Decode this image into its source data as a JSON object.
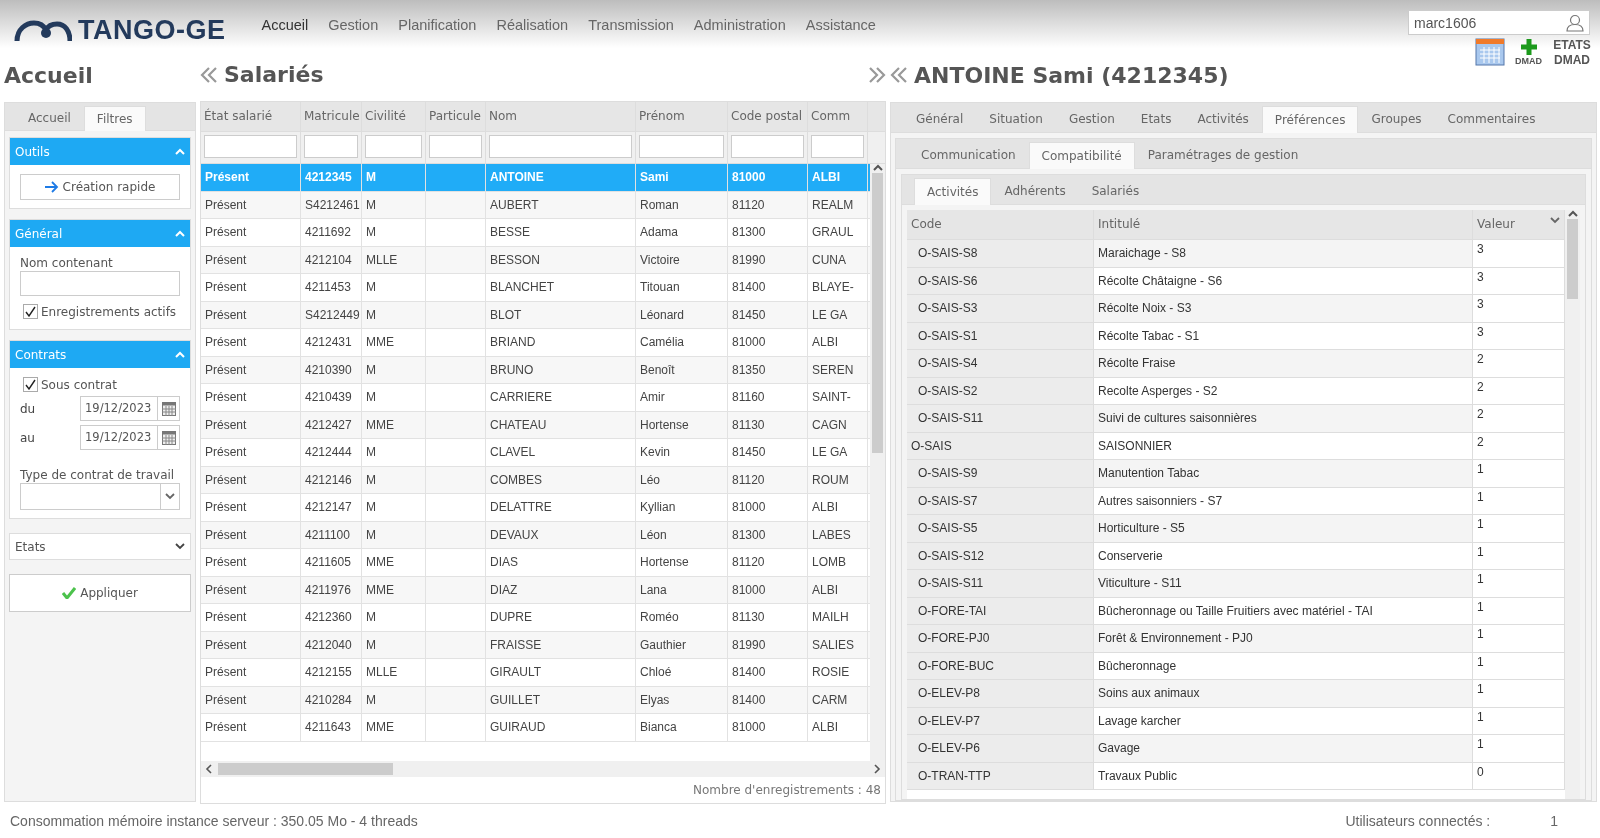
{
  "header": {
    "logo": "TANGO-GE",
    "nav": [
      {
        "label": "Accueil",
        "selected": true
      },
      {
        "label": "Gestion",
        "selected": false
      },
      {
        "label": "Planification",
        "selected": false
      },
      {
        "label": "Réalisation",
        "selected": false
      },
      {
        "label": "Transmission",
        "selected": false
      },
      {
        "label": "Administration",
        "selected": false
      },
      {
        "label": "Assistance",
        "selected": false
      }
    ],
    "user_field": {
      "value": "marc1606"
    },
    "toolbar": [
      {
        "kind": "calendar"
      },
      {
        "kind": "add",
        "label": "DMAD"
      },
      {
        "kind": "text",
        "label": "ETATS DMAD"
      }
    ]
  },
  "left_panel": {
    "title": "Accueil",
    "tabs": [
      {
        "label": "Accueil",
        "selected": false
      },
      {
        "label": "Filtres",
        "selected": true
      }
    ],
    "sections": [
      {
        "kind": "tools",
        "title": "Outils",
        "expanded": true,
        "button": "Création rapide"
      },
      {
        "kind": "general",
        "title": "Général",
        "expanded": true,
        "field_label": "Nom contenant",
        "checkbox": {
          "label": "Enregistrements actifs",
          "checked": true
        }
      },
      {
        "kind": "contracts",
        "title": "Contrats",
        "expanded": true,
        "checkbox": {
          "label": "Sous contrat",
          "checked": true
        },
        "dates": [
          {
            "label": "du",
            "value": "19/12/2023"
          },
          {
            "label": "au",
            "value": "19/12/2023"
          }
        ],
        "select_label": "Type de contrat de travail"
      }
    ],
    "states_dropdown": "Etats",
    "apply_button": "Appliquer"
  },
  "salaries": {
    "title": "Salariés",
    "columns": [
      "État salarié",
      "Matricule",
      "Civilité",
      "Particule",
      "Nom",
      "Prénom",
      "Code postal",
      "Comm"
    ],
    "rows": [
      {
        "selected": true,
        "cells": [
          "Présent",
          "4212345",
          "M",
          "",
          "ANTOINE",
          "Sami",
          "81000",
          "ALBI"
        ]
      },
      {
        "selected": false,
        "cells": [
          "Présent",
          "S4212461",
          "M",
          "",
          "AUBERT",
          "Roman",
          "81120",
          "REALM"
        ]
      },
      {
        "selected": false,
        "cells": [
          "Présent",
          "4211692",
          "M",
          "",
          "BESSE",
          "Adama",
          "81300",
          "GRAUL"
        ]
      },
      {
        "selected": false,
        "cells": [
          "Présent",
          "4212104",
          "MLLE",
          "",
          "BESSON",
          "Victoire",
          "81990",
          "CUNA"
        ]
      },
      {
        "selected": false,
        "cells": [
          "Présent",
          "4211453",
          "M",
          "",
          "BLANCHET",
          "Titouan",
          "81400",
          "BLAYE-"
        ]
      },
      {
        "selected": false,
        "cells": [
          "Présent",
          "S4212449",
          "M",
          "",
          "BLOT",
          "Léonard",
          "81450",
          "LE GA"
        ]
      },
      {
        "selected": false,
        "cells": [
          "Présent",
          "4212431",
          "MME",
          "",
          "BRIAND",
          "Camélia",
          "81000",
          "ALBI"
        ]
      },
      {
        "selected": false,
        "cells": [
          "Présent",
          "4210390",
          "M",
          "",
          "BRUNO",
          "Benoît",
          "81350",
          "SEREN"
        ]
      },
      {
        "selected": false,
        "cells": [
          "Présent",
          "4210439",
          "M",
          "",
          "CARRIERE",
          "Amir",
          "81160",
          "SAINT-"
        ]
      },
      {
        "selected": false,
        "cells": [
          "Présent",
          "4212427",
          "MME",
          "",
          "CHATEAU",
          "Hortense",
          "81130",
          "CAGN"
        ]
      },
      {
        "selected": false,
        "cells": [
          "Présent",
          "4212444",
          "M",
          "",
          "CLAVEL",
          "Kevin",
          "81450",
          "LE GA"
        ]
      },
      {
        "selected": false,
        "cells": [
          "Présent",
          "4212146",
          "M",
          "",
          "COMBES",
          "Léo",
          "81120",
          "ROUM"
        ]
      },
      {
        "selected": false,
        "cells": [
          "Présent",
          "4212147",
          "M",
          "",
          "DELATTRE",
          "Kyllian",
          "81000",
          "ALBI"
        ]
      },
      {
        "selected": false,
        "cells": [
          "Présent",
          "4211100",
          "M",
          "",
          "DEVAUX",
          "Léon",
          "81300",
          "LABES"
        ]
      },
      {
        "selected": false,
        "cells": [
          "Présent",
          "4211605",
          "MME",
          "",
          "DIAS",
          "Hortense",
          "81120",
          "LOMB"
        ]
      },
      {
        "selected": false,
        "cells": [
          "Présent",
          "4211976",
          "MME",
          "",
          "DIAZ",
          "Lana",
          "81000",
          "ALBI"
        ]
      },
      {
        "selected": false,
        "cells": [
          "Présent",
          "4212360",
          "M",
          "",
          "DUPRE",
          "Roméo",
          "81130",
          "MAILH"
        ]
      },
      {
        "selected": false,
        "cells": [
          "Présent",
          "4212040",
          "M",
          "",
          "FRAISSE",
          "Gauthier",
          "81990",
          "SALIES"
        ]
      },
      {
        "selected": false,
        "cells": [
          "Présent",
          "4212155",
          "MLLE",
          "",
          "GIRAULT",
          "Chloé",
          "81400",
          "ROSIE"
        ]
      },
      {
        "selected": false,
        "cells": [
          "Présent",
          "4210284",
          "M",
          "",
          "GUILLET",
          "Elyas",
          "81400",
          "CARM"
        ]
      },
      {
        "selected": false,
        "cells": [
          "Présent",
          "4211643",
          "MME",
          "",
          "GUIRAUD",
          "Bianca",
          "81000",
          "ALBI"
        ]
      }
    ],
    "record_count": "Nombre d'enregistrements : 48"
  },
  "detail": {
    "title": "ANTOINE Sami (4212345)",
    "tabs": [
      {
        "label": "Général",
        "selected": false
      },
      {
        "label": "Situation",
        "selected": false
      },
      {
        "label": "Gestion",
        "selected": false
      },
      {
        "label": "Etats",
        "selected": false
      },
      {
        "label": "Activités",
        "selected": false
      },
      {
        "label": "Préférences",
        "selected": true
      },
      {
        "label": "Groupes",
        "selected": false
      },
      {
        "label": "Commentaires",
        "selected": false
      }
    ],
    "subtabs": [
      {
        "label": "Communication",
        "selected": false
      },
      {
        "label": "Compatibilité",
        "selected": true
      },
      {
        "label": "Paramétrages de gestion",
        "selected": false
      }
    ],
    "inner_tabs": [
      {
        "label": "Activités",
        "selected": true
      },
      {
        "label": "Adhérents",
        "selected": false
      },
      {
        "label": "Salariés",
        "selected": false
      }
    ],
    "columns": [
      "Code",
      "Intitulé",
      "Valeur"
    ],
    "rows": [
      {
        "kind": "item",
        "code": "O-SAIS-S8",
        "label": "Maraichage - S8",
        "value": "3"
      },
      {
        "kind": "item",
        "code": "O-SAIS-S6",
        "label": "Récolte Châtaigne - S6",
        "value": "3"
      },
      {
        "kind": "item",
        "code": "O-SAIS-S3",
        "label": "Récolte Noix - S3",
        "value": "3"
      },
      {
        "kind": "item",
        "code": "O-SAIS-S1",
        "label": "Récolte Tabac - S1",
        "value": "3"
      },
      {
        "kind": "item",
        "code": "O-SAIS-S4",
        "label": "Récolte Fraise",
        "value": "2"
      },
      {
        "kind": "item",
        "code": "O-SAIS-S2",
        "label": "Recolte Asperges - S2",
        "value": "2"
      },
      {
        "kind": "item",
        "code": "O-SAIS-S11",
        "label": "Suivi de cultures saisonnières",
        "value": "2"
      },
      {
        "kind": "group",
        "code": "O-SAIS",
        "label": "SAISONNIER",
        "value": "2"
      },
      {
        "kind": "item",
        "code": "O-SAIS-S9",
        "label": "Manutention Tabac",
        "value": "1"
      },
      {
        "kind": "item",
        "code": "O-SAIS-S7",
        "label": "Autres saisonniers - S7",
        "value": "1"
      },
      {
        "kind": "item",
        "code": "O-SAIS-S5",
        "label": "Horticulture - S5",
        "value": "1"
      },
      {
        "kind": "item",
        "code": "O-SAIS-S12",
        "label": "Conserverie",
        "value": "1"
      },
      {
        "kind": "item",
        "code": "O-SAIS-S11",
        "label": "Viticulture - S11",
        "value": "1"
      },
      {
        "kind": "item",
        "code": "O-FORE-TAI",
        "label": "Bûcheronnage ou Taille Fruitiers avec matériel - TAI",
        "value": "1"
      },
      {
        "kind": "item",
        "code": "O-FORE-PJ0",
        "label": "Forêt & Environnement - PJ0",
        "value": "1"
      },
      {
        "kind": "item",
        "code": "O-FORE-BUC",
        "label": "Bûcheronnage",
        "value": "1"
      },
      {
        "kind": "item",
        "code": "O-ELEV-P8",
        "label": "Soins aux animaux",
        "value": "1"
      },
      {
        "kind": "item",
        "code": "O-ELEV-P7",
        "label": "Lavage karcher",
        "value": "1"
      },
      {
        "kind": "item",
        "code": "O-ELEV-P6",
        "label": "Gavage",
        "value": "1"
      },
      {
        "kind": "item",
        "code": "O-TRAN-TTP",
        "label": "Travaux Public",
        "value": "0"
      }
    ]
  },
  "footer": {
    "memory": "Consommation mémoire instance serveur : 350.05 Mo - 4 threads",
    "users_label": "Utilisateurs connectés :",
    "users_count": "1"
  }
}
